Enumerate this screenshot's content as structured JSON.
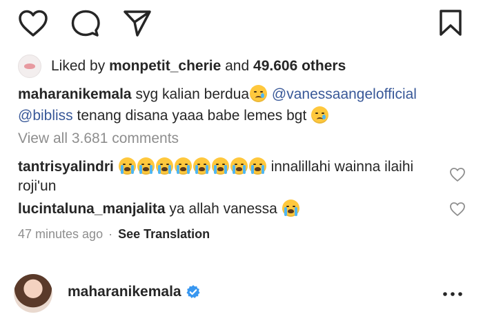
{
  "likes": {
    "prefix": "Liked by",
    "user": "monpetit_cherie",
    "conjunction": "and",
    "count": "49.606 others"
  },
  "caption": {
    "username": "maharanikemala",
    "text1": "syg kalian berdua",
    "mention1": "@vanessaangelofficial",
    "mention2": "@bibliss",
    "text2": "tenang disana yaaa babe  lemes bgt"
  },
  "view_all": "View all 3.681 comments",
  "comments": [
    {
      "username": "tantrisyalindri",
      "emoji": "loudly-crying-face x8",
      "text": "innalillahi wainna ilaihi roji'un"
    },
    {
      "username": "lucintaluna_manjalita",
      "text": "ya allah vanessa",
      "emoji": "loudly-crying-face"
    }
  ],
  "meta": {
    "time": "47 minutes ago",
    "separator": "·",
    "translate": "See Translation"
  },
  "next_post": {
    "username": "maharanikemala"
  },
  "colors": {
    "text": "#262626",
    "muted": "#8e8e8e",
    "link": "#385898",
    "verified": "#3897f0"
  },
  "icons": [
    "heart-icon",
    "comment-icon",
    "share-icon",
    "bookmark-icon",
    "verified-icon",
    "more-icon"
  ]
}
